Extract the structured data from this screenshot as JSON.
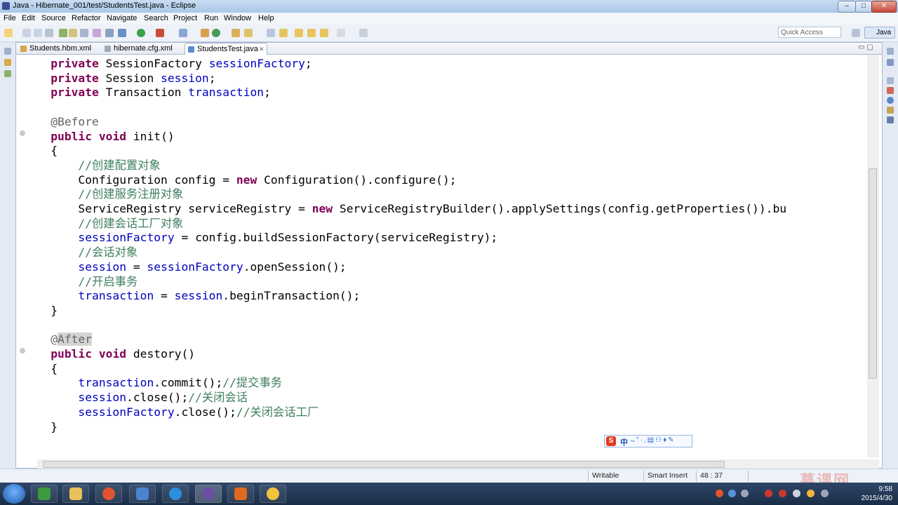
{
  "window": {
    "title": "Java - Hibernate_001/test/StudentsTest.java - Eclipse"
  },
  "menu": [
    "File",
    "Edit",
    "Source",
    "Refactor",
    "Navigate",
    "Search",
    "Project",
    "Run",
    "Window",
    "Help"
  ],
  "toolbar": {
    "quick_access_placeholder": "Quick Access",
    "perspective": "Java"
  },
  "tabs": [
    {
      "label": "Students.hbm.xml",
      "active": false
    },
    {
      "label": "hibernate.cfg.xml",
      "active": false
    },
    {
      "label": "StudentsTest.java",
      "active": true,
      "close": "✕"
    }
  ],
  "code_lines": [
    [
      {
        "t": "    ",
        "c": ""
      },
      {
        "t": "private",
        "c": "kw"
      },
      {
        "t": " SessionFactory ",
        "c": ""
      },
      {
        "t": "sessionFactory",
        "c": "fld"
      },
      {
        "t": ";",
        "c": ""
      }
    ],
    [
      {
        "t": "    ",
        "c": ""
      },
      {
        "t": "private",
        "c": "kw"
      },
      {
        "t": " Session ",
        "c": ""
      },
      {
        "t": "session",
        "c": "fld"
      },
      {
        "t": ";",
        "c": ""
      }
    ],
    [
      {
        "t": "    ",
        "c": ""
      },
      {
        "t": "private",
        "c": "kw"
      },
      {
        "t": " Transaction ",
        "c": ""
      },
      {
        "t": "transaction",
        "c": "fld"
      },
      {
        "t": ";",
        "c": ""
      }
    ],
    [],
    [
      {
        "t": "    ",
        "c": ""
      },
      {
        "t": "@Before",
        "c": "ann"
      }
    ],
    [
      {
        "t": "    ",
        "c": ""
      },
      {
        "t": "public",
        "c": "kw"
      },
      {
        "t": " ",
        "c": ""
      },
      {
        "t": "void",
        "c": "kw"
      },
      {
        "t": " init()",
        "c": ""
      }
    ],
    [
      {
        "t": "    {",
        "c": ""
      }
    ],
    [
      {
        "t": "        ",
        "c": ""
      },
      {
        "t": "//创建配置对象",
        "c": "cmt"
      }
    ],
    [
      {
        "t": "        Configuration config = ",
        "c": ""
      },
      {
        "t": "new",
        "c": "kw"
      },
      {
        "t": " Configuration().configure();",
        "c": ""
      }
    ],
    [
      {
        "t": "        ",
        "c": ""
      },
      {
        "t": "//创建服务注册对象",
        "c": "cmt"
      }
    ],
    [
      {
        "t": "        ServiceRegistry serviceRegistry = ",
        "c": ""
      },
      {
        "t": "new",
        "c": "kw"
      },
      {
        "t": " ServiceRegistryBuilder().applySettings(config.getProperties()).bu",
        "c": ""
      }
    ],
    [
      {
        "t": "        ",
        "c": ""
      },
      {
        "t": "//创建会话工厂对象",
        "c": "cmt"
      }
    ],
    [
      {
        "t": "        ",
        "c": ""
      },
      {
        "t": "sessionFactory",
        "c": "fld"
      },
      {
        "t": " = config.buildSessionFactory(serviceRegistry);",
        "c": ""
      }
    ],
    [
      {
        "t": "        ",
        "c": ""
      },
      {
        "t": "//会话对象",
        "c": "cmt"
      }
    ],
    [
      {
        "t": "        ",
        "c": ""
      },
      {
        "t": "session",
        "c": "fld"
      },
      {
        "t": " = ",
        "c": ""
      },
      {
        "t": "sessionFactory",
        "c": "fld"
      },
      {
        "t": ".openSession();",
        "c": ""
      }
    ],
    [
      {
        "t": "        ",
        "c": ""
      },
      {
        "t": "//开启事务",
        "c": "cmt"
      }
    ],
    [
      {
        "t": "        ",
        "c": ""
      },
      {
        "t": "transaction",
        "c": "fld"
      },
      {
        "t": " = ",
        "c": ""
      },
      {
        "t": "session",
        "c": "fld"
      },
      {
        "t": ".beginTransaction();",
        "c": ""
      }
    ],
    [
      {
        "t": "    }",
        "c": ""
      }
    ],
    [],
    [
      {
        "t": "    ",
        "c": ""
      },
      {
        "t": "@",
        "c": "ann"
      },
      {
        "t": "After",
        "c": "ann hl"
      }
    ],
    [
      {
        "t": "    ",
        "c": ""
      },
      {
        "t": "public",
        "c": "kw"
      },
      {
        "t": " ",
        "c": ""
      },
      {
        "t": "void",
        "c": "kw"
      },
      {
        "t": " destory()",
        "c": ""
      }
    ],
    [
      {
        "t": "    {",
        "c": ""
      }
    ],
    [
      {
        "t": "        ",
        "c": ""
      },
      {
        "t": "transaction",
        "c": "fld"
      },
      {
        "t": ".commit();",
        "c": ""
      },
      {
        "t": "//提交事务",
        "c": "cmt"
      }
    ],
    [
      {
        "t": "        ",
        "c": ""
      },
      {
        "t": "session",
        "c": "fld"
      },
      {
        "t": ".close();",
        "c": ""
      },
      {
        "t": "//关闭会话",
        "c": "cmt"
      }
    ],
    [
      {
        "t": "        ",
        "c": ""
      },
      {
        "t": "sessionFactory",
        "c": "fld"
      },
      {
        "t": ".close();",
        "c": ""
      },
      {
        "t": "//关闭会话工厂",
        "c": "cmt"
      }
    ],
    [
      {
        "t": "    }",
        "c": ""
      }
    ]
  ],
  "status": {
    "mode": "Writable",
    "insert": "Smart Insert",
    "position": "48 : 37"
  },
  "ime": {
    "logo": "S",
    "lang": "中",
    "tools": "ᴗ°·,▤⚇♦✎"
  },
  "taskbar": {
    "time": "9:58",
    "date": "2015/4/30"
  },
  "watermark": "慕课网",
  "colors": {
    "keyword": "#7f0055",
    "field": "#0000c0",
    "comment": "#3f7f5f",
    "annotation": "#646464"
  }
}
